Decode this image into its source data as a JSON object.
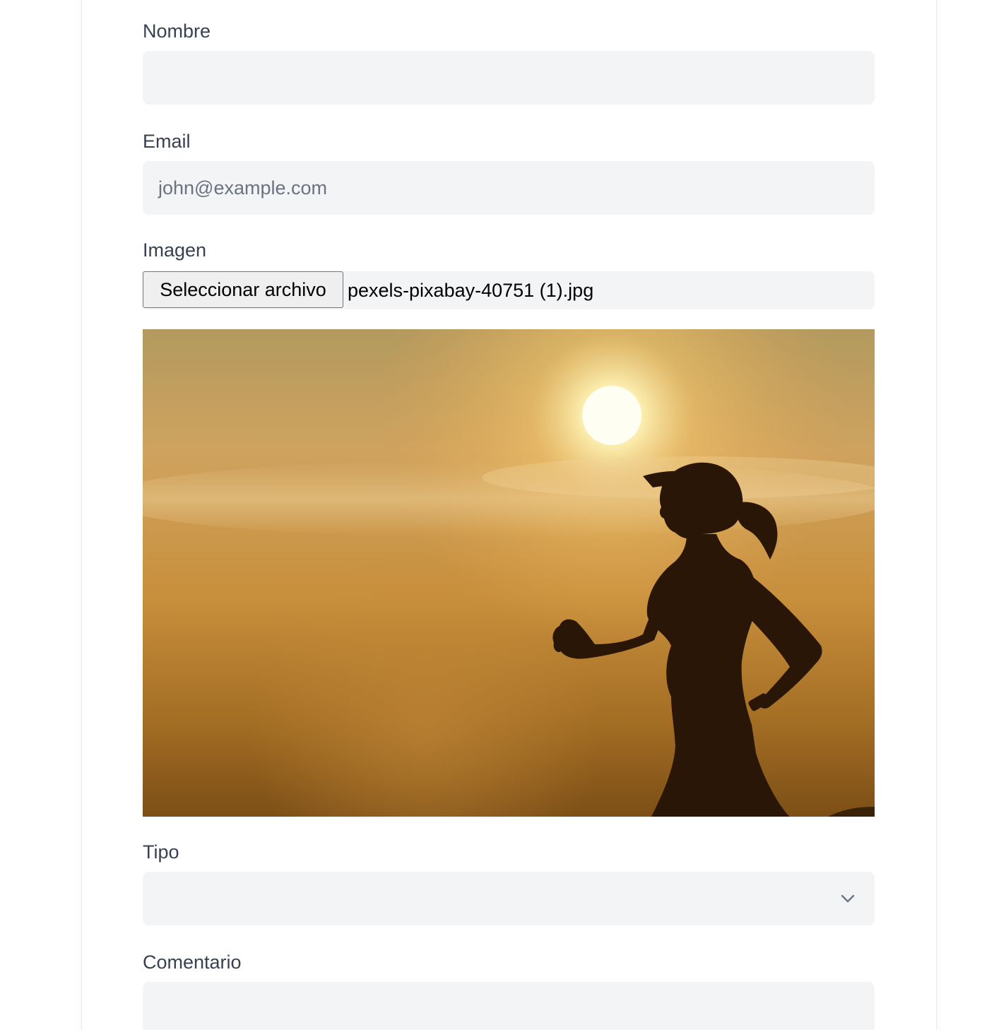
{
  "form": {
    "name_label": "Nombre",
    "name_value": "",
    "email_label": "Email",
    "email_placeholder": "john@example.com",
    "image_label": "Imagen",
    "file_button_label": "Seleccionar archivo",
    "file_name": "pexels-pixabay-40751 (1).jpg",
    "type_label": "Tipo",
    "type_selected": "",
    "comment_label": "Comentario",
    "comment_value": ""
  },
  "icons": {
    "select_arrow": "chevron-down-icon"
  },
  "colors": {
    "label": "#374151",
    "field_bg": "#f3f4f6",
    "placeholder": "#6b7280"
  }
}
